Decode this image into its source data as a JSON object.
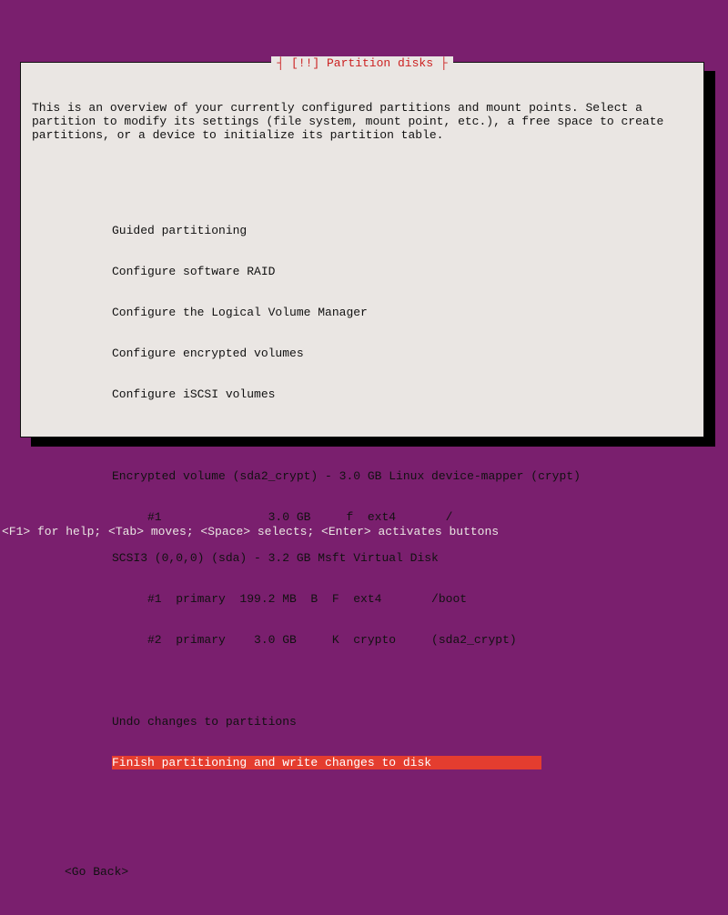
{
  "dialog": {
    "title_prefix": "┤ ",
    "title_marker": "[!!]",
    "title_text": " Partition disks",
    "title_suffix": " ├",
    "intro": "This is an overview of your currently configured partitions and mount points. Select a partition to modify its settings (file system, mount point, etc.), a free space to create partitions, or a device to initialize its partition table.",
    "goback": "<Go Back>"
  },
  "menu": {
    "guided": "Guided partitioning",
    "raid": "Configure software RAID",
    "lvm": "Configure the Logical Volume Manager",
    "encrypted": "Configure encrypted volumes",
    "iscsi": "Configure iSCSI volumes",
    "device1": "Encrypted volume (sda2_crypt) - 3.0 GB Linux device-mapper (crypt)",
    "device1_p1": "     #1               3.0 GB     f  ext4       /",
    "device2": "SCSI3 (0,0,0) (sda) - 3.2 GB Msft Virtual Disk",
    "device2_p1": "     #1  primary  199.2 MB  B  F  ext4       /boot",
    "device2_p2": "     #2  primary    3.0 GB     K  crypto     (sda2_crypt)",
    "undo": "Undo changes to partitions",
    "finish": "Finish partitioning and write changes to disk               "
  },
  "footer": {
    "help": "<F1> for help; <Tab> moves; <Space> selects; <Enter> activates buttons"
  }
}
